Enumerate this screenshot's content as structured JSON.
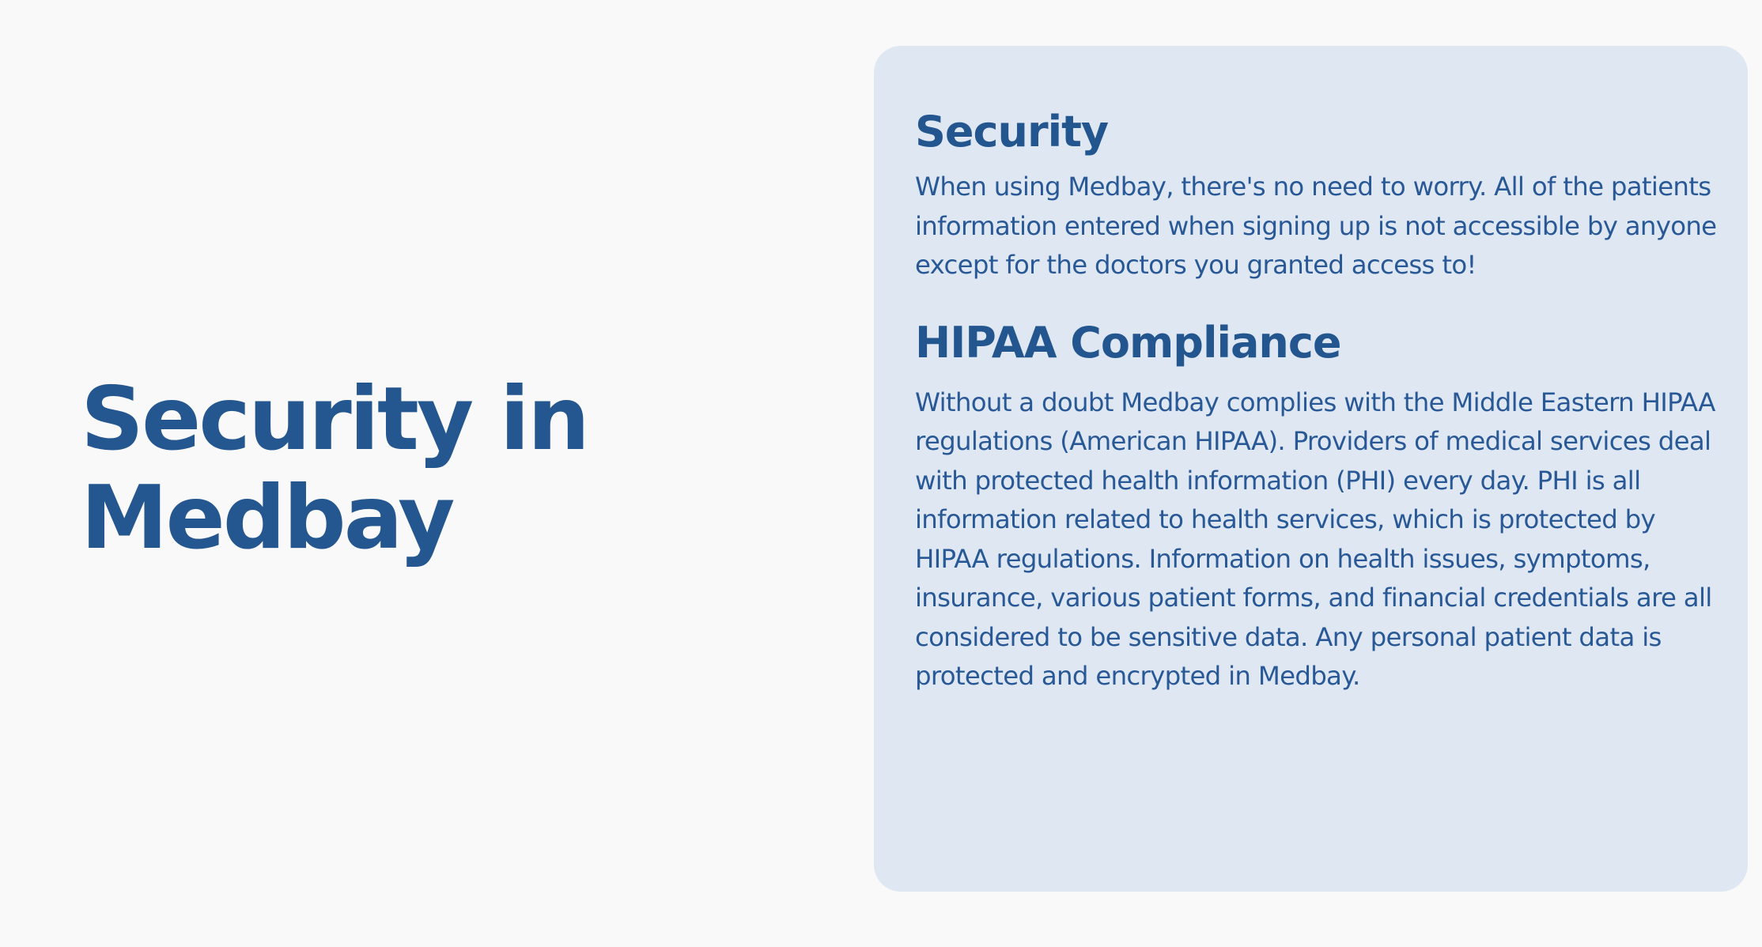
{
  "hero": {
    "title_line1": "Security in",
    "title_line2": "Medbay"
  },
  "card": {
    "security": {
      "heading": "Security",
      "body": "When using Medbay, there's no need to worry. All of the patients information entered when signing up is not accessible by anyone except for the doctors you granted access to!"
    },
    "hipaa": {
      "heading": "HIPAA Compliance",
      "body": "Without a doubt Medbay complies with the Middle Eastern HIPAA regulations (American HIPAA). Providers of medical services deal with protected health information (PHI) every day. PHI is all information related to health services, which is protected by HIPAA regulations. Information on health issues, symptoms, insurance, various patient forms, and financial credentials are all considered to be sensitive data. Any personal patient data is protected and encrypted in Medbay."
    }
  },
  "colors": {
    "background": "#f9f9fa",
    "card_background": "#dfe8f2",
    "primary_text": "#23558f"
  }
}
